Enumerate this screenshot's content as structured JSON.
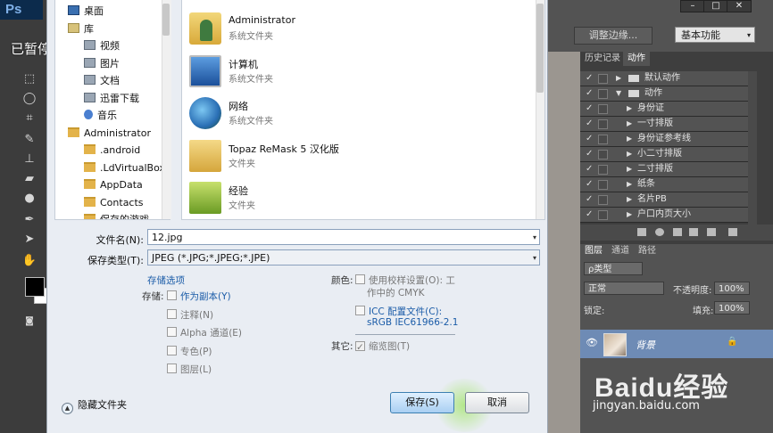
{
  "overlay": {
    "paused": "已暂停"
  },
  "photoshop": {
    "logo": "Ps",
    "refine_edge": "调整边缘...",
    "workspace": "基本功能",
    "panel_tabs": [
      "历史记录",
      "动作"
    ],
    "actions": [
      {
        "label": "默认动作",
        "level": 0,
        "expanded": false,
        "checked": true
      },
      {
        "label": "动作",
        "level": 0,
        "expanded": true,
        "checked": true
      },
      {
        "label": "身份证",
        "level": 1,
        "checked": true
      },
      {
        "label": "一寸排版",
        "level": 1,
        "checked": true
      },
      {
        "label": "身份证参考线",
        "level": 1,
        "checked": true
      },
      {
        "label": "小二寸排版",
        "level": 1,
        "checked": true
      },
      {
        "label": "二寸排版",
        "level": 1,
        "checked": true
      },
      {
        "label": "纸条",
        "level": 1,
        "checked": true
      },
      {
        "label": "名片PB",
        "level": 1,
        "checked": true
      },
      {
        "label": "户口内页大小",
        "level": 1,
        "checked": true
      }
    ],
    "layers_tabs": [
      "图层",
      "通道",
      "路径"
    ],
    "layer_filter": "ρ类型",
    "blend_mode": "正常",
    "opacity_label": "不透明度:",
    "opacity_value": "100%",
    "lock_label": "锁定:",
    "fill_label": "填充:",
    "fill_value": "100%",
    "layer_name": "背景"
  },
  "dialog": {
    "nav": [
      {
        "label": "桌面",
        "icon": "desktop-icon",
        "indent": 0
      },
      {
        "label": "库",
        "icon": "library-icon",
        "indent": 0
      },
      {
        "label": "视频",
        "icon": "video-icon",
        "indent": 1
      },
      {
        "label": "图片",
        "icon": "picture-icon",
        "indent": 1
      },
      {
        "label": "文档",
        "icon": "document-icon",
        "indent": 1
      },
      {
        "label": "迅雷下载",
        "icon": "download-icon",
        "indent": 1
      },
      {
        "label": "音乐",
        "icon": "music-icon",
        "indent": 1
      },
      {
        "label": "Administrator",
        "icon": "folder-icon",
        "indent": 0
      },
      {
        "label": ".android",
        "icon": "folder-icon",
        "indent": 1
      },
      {
        "label": ".LdVirtualBox",
        "icon": "folder-icon",
        "indent": 1
      },
      {
        "label": "AppData",
        "icon": "folder-icon",
        "indent": 1
      },
      {
        "label": "Contacts",
        "icon": "folder-icon",
        "indent": 1
      },
      {
        "label": "保存的游戏",
        "icon": "folder-icon",
        "indent": 1
      }
    ],
    "files": [
      {
        "name": "Administrator",
        "type": "系统文件夹",
        "icon": "user-folder-icon"
      },
      {
        "name": "计算机",
        "type": "系统文件夹",
        "icon": "computer-icon"
      },
      {
        "name": "网络",
        "type": "系统文件夹",
        "icon": "network-icon"
      },
      {
        "name": "Topaz ReMask 5 汉化版",
        "type": "文件夹",
        "icon": "folder-icon"
      },
      {
        "name": "经验",
        "type": "文件夹",
        "icon": "folder-icon"
      }
    ],
    "filename_label": "文件名(N):",
    "filename_value": "12.jpg",
    "filetype_label": "保存类型(T):",
    "filetype_value": "JPEG (*.JPG;*.JPEG;*.JPE)",
    "save_options_title": "存储选项",
    "save_label": "存储:",
    "save_options": [
      {
        "label": "作为副本(Y)",
        "enabled": true
      },
      {
        "label": "注释(N)",
        "enabled": false
      },
      {
        "label": "Alpha 通道(E)",
        "enabled": false
      },
      {
        "label": "专色(P)",
        "enabled": false
      },
      {
        "label": "图层(L)",
        "enabled": false
      }
    ],
    "color_label": "颜色:",
    "proof_setup": "使用校样设置(O): 工",
    "proof_setup_2": "作中的 CMYK",
    "icc_label": "ICC 配置文件(C):",
    "icc_value": "sRGB IEC61966-2.1",
    "other_label": "其它:",
    "thumbnail": "缩览图(T)",
    "hide_folders": "隐藏文件夹",
    "save_button": "保存(S)",
    "cancel_button": "取消"
  },
  "watermark": {
    "logo": "Baidu经验",
    "url": "jingyan.baidu.com"
  }
}
